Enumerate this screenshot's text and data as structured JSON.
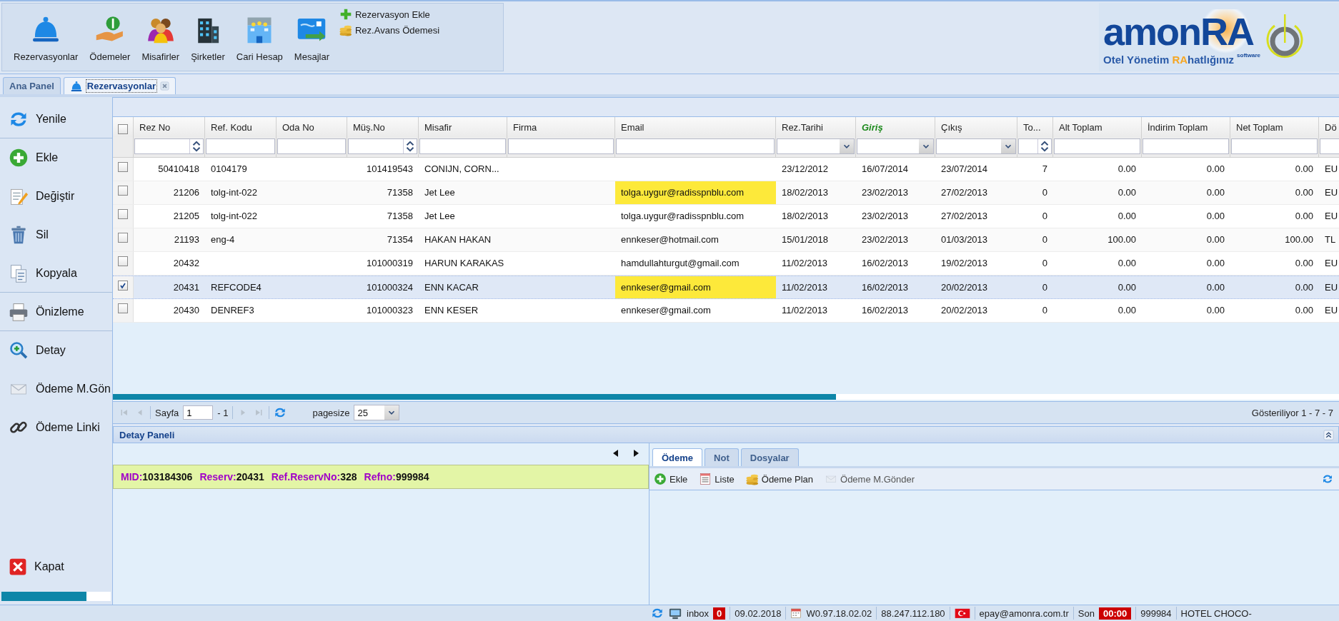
{
  "toolbar": {
    "buttons": [
      {
        "label": "Rezervasyonlar"
      },
      {
        "label": "Ödemeler"
      },
      {
        "label": "Misafirler"
      },
      {
        "label": "Şirketler"
      },
      {
        "label": "Cari Hesap"
      },
      {
        "label": "Mesajlar"
      }
    ],
    "quick_actions": [
      {
        "label": "Rezervasyon Ekle"
      },
      {
        "label": "Rez.Avans Ödemesi"
      }
    ]
  },
  "logo": {
    "brand": "amon",
    "brand_accent": "RA",
    "tagline_before": "Otel Yönetim ",
    "tagline_accent": "RA",
    "tagline_after": "hatlığınız",
    "subtitle": "software"
  },
  "tabs": [
    {
      "label": "Ana Panel",
      "selected": false,
      "closable": false
    },
    {
      "label": "Rezervasyonlar",
      "selected": true,
      "closable": true
    }
  ],
  "sidebar": {
    "items": [
      {
        "label": "Yenile",
        "separator_after": true
      },
      {
        "label": "Ekle",
        "separator_after": false
      },
      {
        "label": "Değiştir",
        "separator_after": false
      },
      {
        "label": "Sil",
        "separator_after": false
      },
      {
        "label": "Kopyala",
        "separator_after": true
      },
      {
        "label": "Önizleme",
        "separator_after": true
      },
      {
        "label": "Detay",
        "separator_after": false
      },
      {
        "label": "Ödeme M.Gön",
        "separator_after": false
      },
      {
        "label": "Ödeme Linki",
        "separator_after": false
      }
    ],
    "close_button": {
      "label": "Kapat"
    },
    "progress": {
      "level": 0.78
    }
  },
  "grid": {
    "select_all_checked": false,
    "columns": [
      {
        "label": "Rez No",
        "kind": "number",
        "highlighted": false
      },
      {
        "label": "Ref. Kodu",
        "kind": "text",
        "highlighted": false
      },
      {
        "label": "Oda No",
        "kind": "text",
        "highlighted": false
      },
      {
        "label": "Müş.No",
        "kind": "number",
        "highlighted": false
      },
      {
        "label": "Misafir",
        "kind": "text",
        "highlighted": false
      },
      {
        "label": "Firma",
        "kind": "text",
        "highlighted": false
      },
      {
        "label": "Email",
        "kind": "email",
        "highlighted": false
      },
      {
        "label": "Rez.Tarihi",
        "kind": "text",
        "highlighted": false
      },
      {
        "label": "Giriş",
        "kind": "text",
        "highlighted": true
      },
      {
        "label": "Çıkış",
        "kind": "text",
        "highlighted": false
      },
      {
        "label": "To...",
        "kind": "number",
        "highlighted": false
      },
      {
        "label": "Alt Toplam",
        "kind": "number",
        "highlighted": false
      },
      {
        "label": "İndirim Toplam",
        "kind": "number",
        "highlighted": false
      },
      {
        "label": "Net Toplam",
        "kind": "number",
        "highlighted": false
      },
      {
        "label": "Dö",
        "kind": "text",
        "highlighted": false
      }
    ],
    "filters": [
      {
        "kind": "spin"
      },
      {
        "kind": "text"
      },
      {
        "kind": "text"
      },
      {
        "kind": "spin"
      },
      {
        "kind": "text"
      },
      {
        "kind": "text"
      },
      {
        "kind": "text"
      },
      {
        "kind": "dropdown"
      },
      {
        "kind": "dropdown"
      },
      {
        "kind": "dropdown"
      },
      {
        "kind": "spin"
      },
      {
        "kind": "text"
      },
      {
        "kind": "text"
      },
      {
        "kind": "text"
      },
      {
        "kind": "text"
      }
    ],
    "rows": [
      {
        "checked": false,
        "selected": false,
        "email_highlighted": false,
        "cells": [
          "50410418",
          "0104179",
          null,
          "101419543",
          "CONIJN, CORN...",
          null,
          null,
          "23/12/2012",
          "16/07/2014",
          "23/07/2014",
          "7",
          "0.00",
          "0.00",
          "0.00",
          "EU"
        ]
      },
      {
        "checked": false,
        "selected": false,
        "email_highlighted": true,
        "cells": [
          "21206",
          "tolg-int-022",
          null,
          "71358",
          "Jet Lee",
          null,
          "tolga.uygur@radisspnblu.com",
          "18/02/2013",
          "23/02/2013",
          "27/02/2013",
          "0",
          "0.00",
          "0.00",
          "0.00",
          "EU"
        ]
      },
      {
        "checked": false,
        "selected": false,
        "email_highlighted": false,
        "cells": [
          "21205",
          "tolg-int-022",
          null,
          "71358",
          "Jet Lee",
          null,
          "tolga.uygur@radisspnblu.com",
          "18/02/2013",
          "23/02/2013",
          "27/02/2013",
          "0",
          "0.00",
          "0.00",
          "0.00",
          "EU"
        ]
      },
      {
        "checked": false,
        "selected": false,
        "email_highlighted": false,
        "cells": [
          "21193",
          "eng-4",
          null,
          "71354",
          "HAKAN HAKAN",
          null,
          "ennkeser@hotmail.com",
          "15/01/2018",
          "23/02/2013",
          "01/03/2013",
          "0",
          "100.00",
          "0.00",
          "100.00",
          "TL"
        ]
      },
      {
        "checked": false,
        "selected": false,
        "email_highlighted": false,
        "cells": [
          "20432",
          null,
          null,
          "101000319",
          "HARUN KARAKAS",
          null,
          "hamdullahturgut@gmail.com",
          "11/02/2013",
          "16/02/2013",
          "19/02/2013",
          "0",
          "0.00",
          "0.00",
          "0.00",
          "EU"
        ]
      },
      {
        "checked": true,
        "selected": true,
        "email_highlighted": true,
        "cells": [
          "20431",
          "REFCODE4",
          null,
          "101000324",
          "ENN KACAR",
          null,
          "ennkeser@gmail.com",
          "11/02/2013",
          "16/02/2013",
          "20/02/2013",
          "0",
          "0.00",
          "0.00",
          "0.00",
          "EU"
        ]
      },
      {
        "checked": false,
        "selected": false,
        "email_highlighted": false,
        "cells": [
          "20430",
          "DENREF3",
          null,
          "101000323",
          "ENN KESER",
          null,
          "ennkeser@gmail.com",
          "11/02/2013",
          "16/02/2013",
          "20/02/2013",
          "0",
          "0.00",
          "0.00",
          "0.00",
          "EU"
        ]
      }
    ]
  },
  "pager": {
    "page_label": "Sayfa",
    "page": "1",
    "page_count": "- 1",
    "pagesize_label": "pagesize",
    "pagesize": "25",
    "summary": "Gösteriliyor 1 - 7 - 7"
  },
  "detail": {
    "title": "Detay Paneli",
    "info": [
      {
        "label": "MID:",
        "value": "103184306"
      },
      {
        "label": "Reserv:",
        "value": "20431"
      },
      {
        "label": "Ref.ReservNo:",
        "value": "328"
      },
      {
        "label": "Refno:",
        "value": "999984"
      }
    ],
    "tabs": [
      {
        "label": "Ödeme",
        "selected": true
      },
      {
        "label": "Not",
        "selected": false
      },
      {
        "label": "Dosyalar",
        "selected": false
      }
    ],
    "actions": [
      {
        "label": "Ekle",
        "disabled": false
      },
      {
        "label": "Liste",
        "disabled": false
      },
      {
        "label": "Ödeme Plan",
        "disabled": false
      },
      {
        "label": "Ödeme M.Gönder",
        "disabled": true
      }
    ]
  },
  "status_bar": {
    "inbox_label": "inbox",
    "inbox_count": "0",
    "date": "09.02.2018",
    "version": "W0.97.18.02.02",
    "ip": "88.247.112.180",
    "email": "epay@amonra.com.tr",
    "timer_label": "Son",
    "timer": "00:00",
    "code": "999984",
    "hotel": "HOTEL CHOCO-"
  }
}
